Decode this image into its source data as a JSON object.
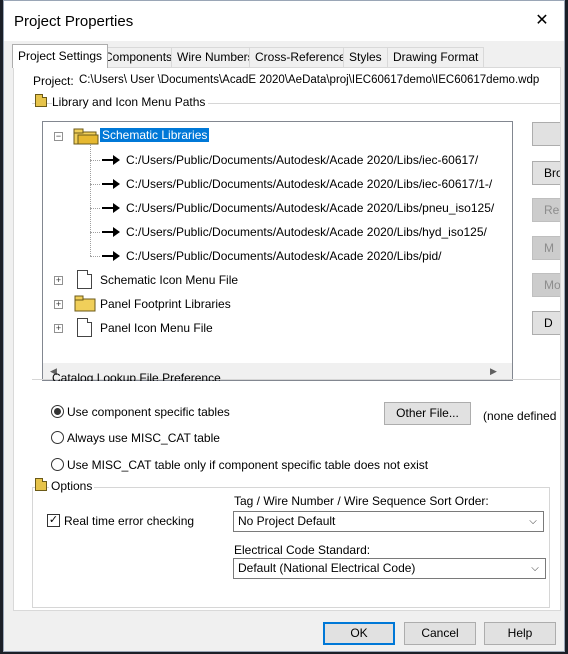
{
  "window": {
    "title": "Project Properties"
  },
  "tabs": [
    {
      "label": "Project Settings",
      "active": true
    },
    {
      "label": "Components"
    },
    {
      "label": "Wire Numbers"
    },
    {
      "label": "Cross-References"
    },
    {
      "label": "Styles"
    },
    {
      "label": "Drawing Format"
    }
  ],
  "project": {
    "label": "Project:",
    "path": "C:\\Users\\  User  \\Documents\\AcadE 2020\\AeData\\proj\\IEC60617demo\\IEC60617demo.wdp"
  },
  "library_group": {
    "label": "Library and Icon Menu Paths",
    "tree": {
      "root_label": "Schematic Libraries",
      "root_paths": [
        "C:/Users/Public/Documents/Autodesk/Acade 2020/Libs/iec-60617/",
        "C:/Users/Public/Documents/Autodesk/Acade 2020/Libs/iec-60617/1-/",
        "C:/Users/Public/Documents/Autodesk/Acade 2020/Libs/pneu_iso125/",
        "C:/Users/Public/Documents/Autodesk/Acade 2020/Libs/hyd_iso125/",
        "C:/Users/Public/Documents/Autodesk/Acade 2020/Libs/pid/"
      ],
      "nodes": [
        "Schematic Icon Menu File",
        "Panel Footprint Libraries",
        "Panel Icon Menu File"
      ]
    },
    "buttons": [
      "",
      "Bro",
      "Re",
      "M",
      "Mov",
      "D"
    ]
  },
  "catalog_group": {
    "label": "Catalog Lookup File Preference",
    "options": [
      {
        "label": "Use component specific tables",
        "checked": true
      },
      {
        "label": "Always use MISC_CAT table",
        "checked": false
      },
      {
        "label": "Use MISC_CAT table only if component specific table does not exist",
        "checked": false
      }
    ],
    "other_file_button": "Other File...",
    "other_file_status": "(none defined"
  },
  "options_group": {
    "label": "Options",
    "realtime_error_checking": {
      "label": "Real time error checking",
      "checked": true
    },
    "sort_order": {
      "label": "Tag / Wire Number / Wire Sequence Sort Order:",
      "value": "No Project Default"
    },
    "electrical_code": {
      "label": "Electrical Code Standard:",
      "value": "Default (National Electrical Code)"
    }
  },
  "footer": {
    "ok": "OK",
    "cancel": "Cancel",
    "help": "Help"
  }
}
